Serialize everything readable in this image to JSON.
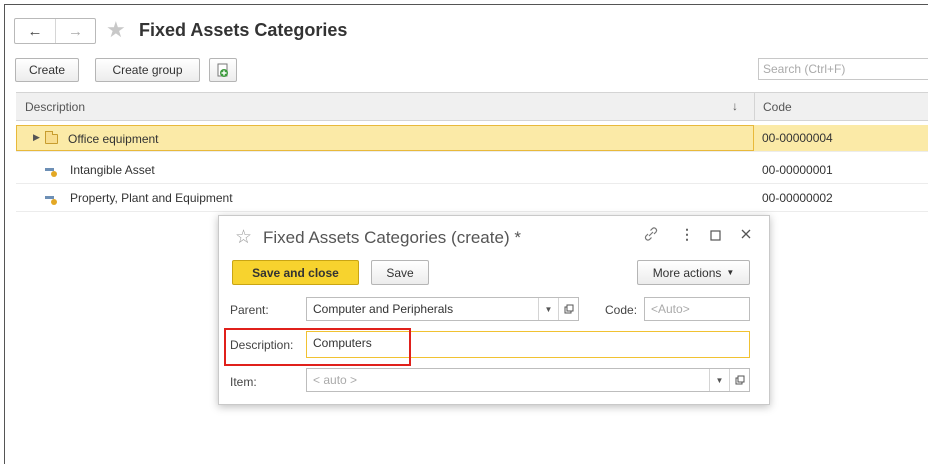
{
  "window": {
    "title": "Fixed Assets Categories",
    "back_icon": "arrow-left-icon",
    "forward_icon": "arrow-right-icon",
    "favorite_icon": "star-icon"
  },
  "toolbar": {
    "create_label": "Create",
    "create_group_label": "Create group",
    "copy_icon": "copy-add-icon",
    "search_placeholder": "Search (Ctrl+F)"
  },
  "table": {
    "columns": {
      "description": "Description",
      "code": "Code"
    },
    "sort_indicator": "↓",
    "rows": [
      {
        "description": "Office equipment",
        "code": "00-00000004",
        "type": "folder",
        "selected": true
      },
      {
        "description": "Intangible Asset",
        "code": "00-00000001",
        "type": "item",
        "selected": false
      },
      {
        "description": "Property, Plant and Equipment",
        "code": "00-00000002",
        "type": "item",
        "selected": false
      }
    ]
  },
  "dialog": {
    "title": "Fixed Assets Categories (create) *",
    "save_and_close_label": "Save and close",
    "save_label": "Save",
    "more_actions_label": "More actions",
    "parent_label": "Parent:",
    "parent_value": "Computer and Peripherals",
    "code_label": "Code:",
    "code_placeholder": "<Auto>",
    "description_label": "Description:",
    "description_value": "Computers",
    "item_label": "Item:",
    "item_placeholder": "< auto >"
  },
  "colors": {
    "primary_button": "#f7d32e",
    "selected_row": "#fbeaa7",
    "highlight_box": "#e0201b"
  }
}
